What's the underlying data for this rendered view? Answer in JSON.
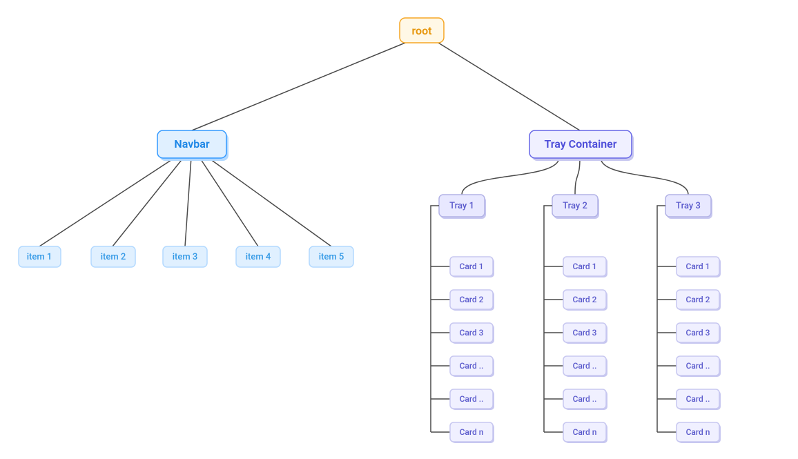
{
  "diagram": {
    "root": {
      "label": "root"
    },
    "navbar": {
      "label": "Navbar",
      "items": [
        {
          "label": "item 1"
        },
        {
          "label": "item 2"
        },
        {
          "label": "item 3"
        },
        {
          "label": "item 4"
        },
        {
          "label": "item 5"
        }
      ]
    },
    "trayContainer": {
      "label": "Tray Container",
      "trays": [
        {
          "label": "Tray 1",
          "cards": [
            {
              "label": "Card 1"
            },
            {
              "label": "Card 2"
            },
            {
              "label": "Card 3"
            },
            {
              "label": "Card .."
            },
            {
              "label": "Card .."
            },
            {
              "label": "Card n"
            }
          ]
        },
        {
          "label": "Tray 2",
          "cards": [
            {
              "label": "Card 1"
            },
            {
              "label": "Card 2"
            },
            {
              "label": "Card 3"
            },
            {
              "label": "Card .."
            },
            {
              "label": "Card .."
            },
            {
              "label": "Card n"
            }
          ]
        },
        {
          "label": "Tray 3",
          "cards": [
            {
              "label": "Card 1"
            },
            {
              "label": "Card 2"
            },
            {
              "label": "Card 3"
            },
            {
              "label": "Card .."
            },
            {
              "label": "Card .."
            },
            {
              "label": "Card n"
            }
          ]
        }
      ]
    }
  },
  "colors": {
    "rootFill": "#fff8e6",
    "rootStroke": "#f5a623",
    "rootText": "#e6950a",
    "blueFill": "#e0f0ff",
    "blueStroke": "#3399ff",
    "blueText": "#1a85e6",
    "purpleFill": "#f0f0ff",
    "purpleStroke": "#6666e6",
    "purpleText": "#4d4dd9",
    "edge": "#4a4a4a"
  }
}
